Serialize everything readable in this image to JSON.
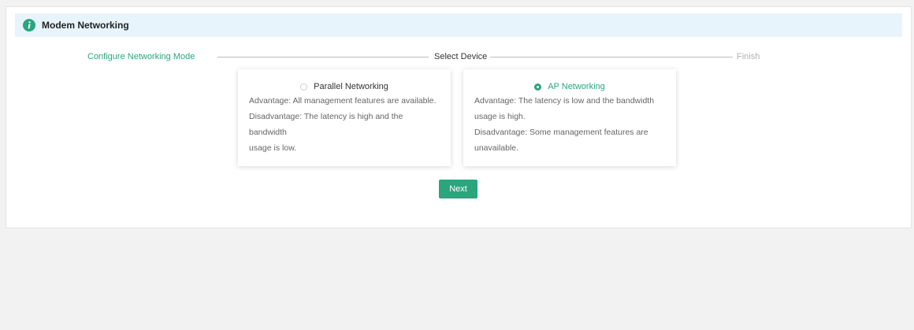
{
  "header": {
    "title": "Modem Networking"
  },
  "steps": [
    {
      "label": "Configure Networking Mode",
      "state": "done"
    },
    {
      "label": "Select Device",
      "state": "active"
    },
    {
      "label": "Finish",
      "state": "pending"
    }
  ],
  "options": [
    {
      "title": "Parallel Networking",
      "selected": false,
      "lines": [
        "Advantage: All management features are available.",
        "Disadvantage: The latency is high and the bandwidth",
        "usage is low."
      ]
    },
    {
      "title": "AP Networking",
      "selected": true,
      "lines": [
        "Advantage: The latency is low and the bandwidth",
        "usage is high.",
        "Disadvantage: Some management features are",
        "unavailable."
      ]
    }
  ],
  "next_label": "Next",
  "colors": {
    "accent": "#2aa57d",
    "header_bg": "#e8f4fc",
    "page_bg": "#f2f2f2"
  }
}
